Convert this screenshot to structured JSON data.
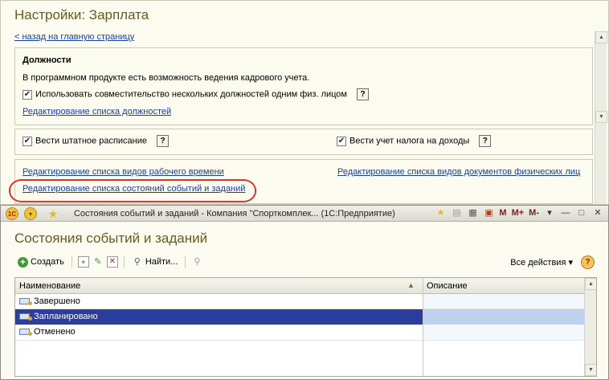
{
  "bg_window": {
    "title": "Настройки: Зарплата",
    "back_link": "< назад на главную страницу",
    "group_positions": {
      "title": "Должности",
      "text": "В программном продукте есть возможность ведения кадрового учета.",
      "checkbox_label": "Использовать совместительство нескольких должностей одним физ. лицом",
      "help": "?",
      "link": "Редактирование списка должностей"
    },
    "group_staff": {
      "left_checkbox": "Вести штатное расписание",
      "right_checkbox": "Вести учет налога на доходы",
      "help": "?"
    },
    "group_links": {
      "link_worktime": "Редактирование списка видов рабочего времени",
      "link_documents": "Редактирование списка видов документов физических лиц",
      "link_states": "Редактирование списка состояний событий и заданий"
    },
    "highlight_color": "#d9352b"
  },
  "fg_window": {
    "titlebar_text": "Состояния событий и заданий - Компания \"Спорткомплек... (1С:Предприятие)",
    "titlebar_buttons": [
      "M",
      "M+",
      "M-"
    ],
    "title": "Состояния событий и заданий",
    "toolbar": {
      "create": "Создать",
      "find": "Найти...",
      "all_actions": "Все действия ▾"
    },
    "table": {
      "col_name": "Наименование",
      "col_desc": "Описание",
      "rows": [
        "Завершено",
        "Запланировано",
        "Отменено"
      ],
      "selected_row": 1
    },
    "colors": {
      "title": "#6b5a1c",
      "selection": "#2b3e9f",
      "link": "#1a3e9e"
    }
  }
}
